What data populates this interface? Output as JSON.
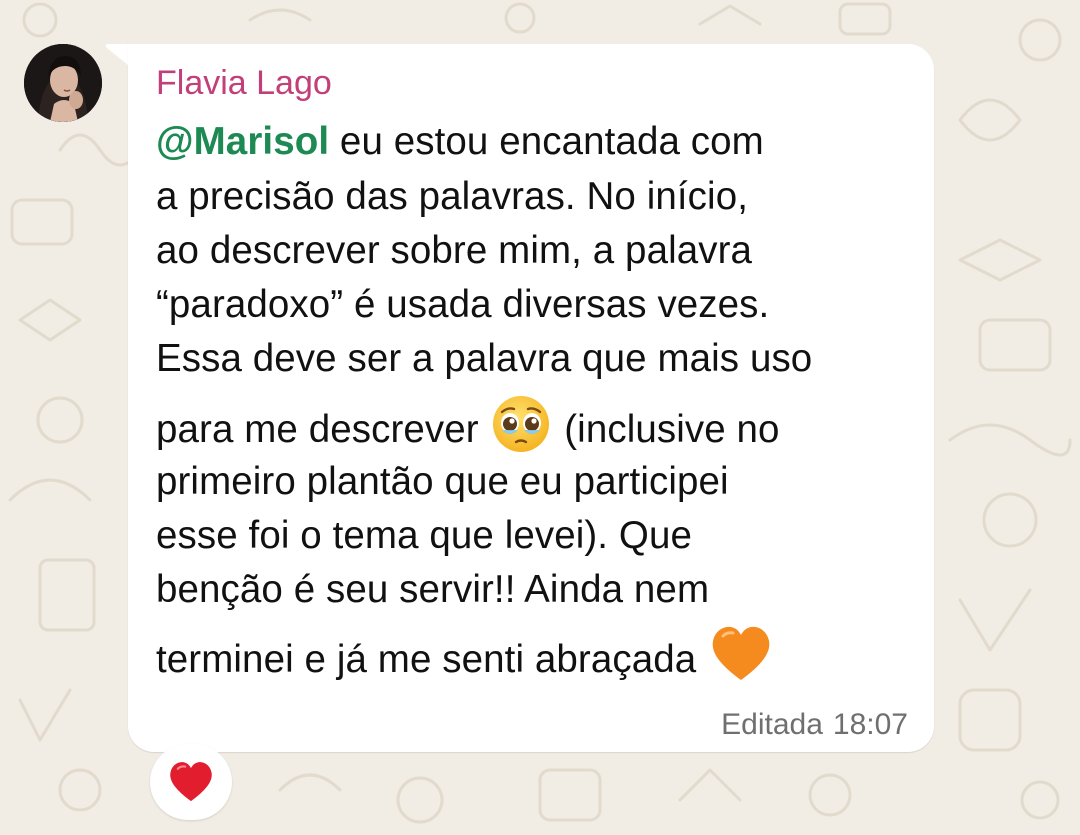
{
  "message": {
    "sender": "Flavia Lago",
    "mention": "@Marisol",
    "lines": [
      " eu estou encantada com",
      "a precisão das palavras. No início,",
      "ao descrever sobre mim, a palavra",
      "“paradoxo” é usada diversas vezes.",
      "Essa deve ser a palavra que mais uso",
      "para me descrever",
      " (inclusive no",
      "primeiro plantão que eu participei",
      "esse foi o tema que levei). Que",
      "benção é seu servir!! Ainda nem",
      "terminei e já me senti abraçada"
    ],
    "edited_label": "Editada",
    "time": "18:07",
    "inline_emojis": [
      "pleading-face-icon",
      "orange-heart-icon"
    ]
  },
  "reaction": {
    "emoji": "red-heart-icon"
  },
  "colors": {
    "sender": "#c2407a",
    "mention": "#1c8a52",
    "bubble": "#ffffff",
    "background": "#f1ece4",
    "meta": "#6f6f6f",
    "heart_red": "#e11d2e",
    "heart_orange": "#f58a1f"
  }
}
